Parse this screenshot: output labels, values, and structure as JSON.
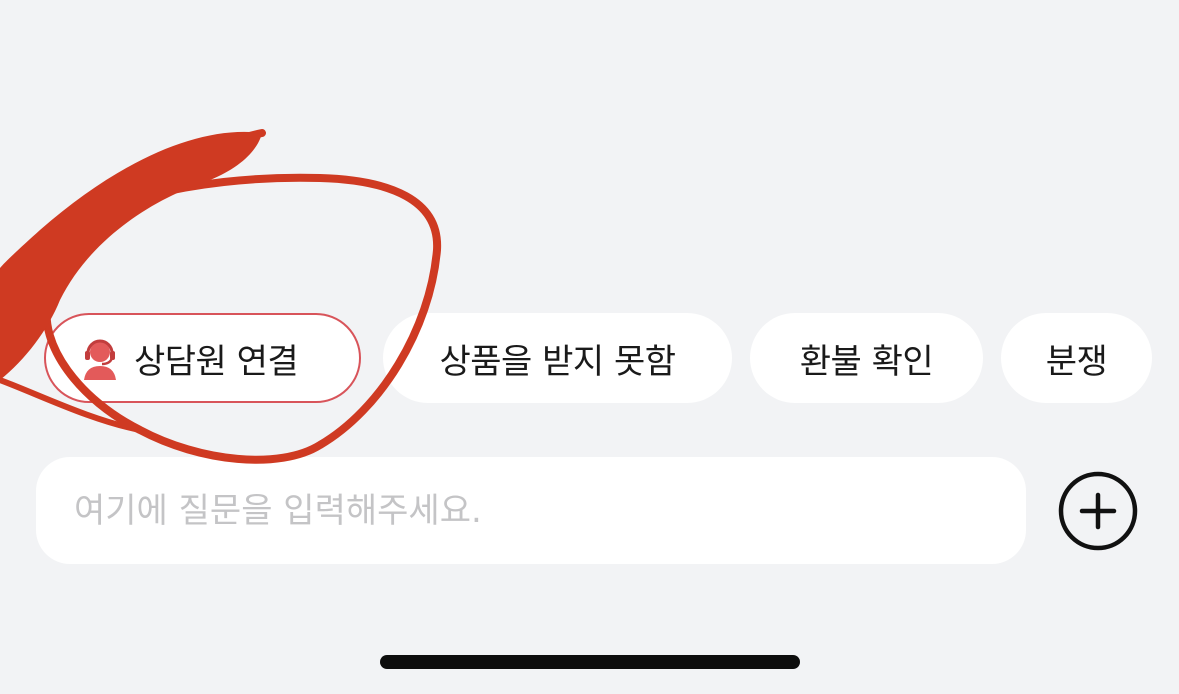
{
  "quick_replies": {
    "agent": {
      "label": "상담원 연결",
      "icon": "headset-agent-icon"
    },
    "product_not_received": {
      "label": "상품을 받지 못함"
    },
    "refund_check": {
      "label": "환불 확인"
    },
    "dispute": {
      "label": "분쟁"
    }
  },
  "composer": {
    "placeholder": "여기에 질문을 입력해주세요.",
    "value": "",
    "add_icon": "plus-circle-icon"
  },
  "colors": {
    "background": "#f2f3f5",
    "agent_accent": "#d8545a",
    "annotation": "#cf3a22"
  }
}
